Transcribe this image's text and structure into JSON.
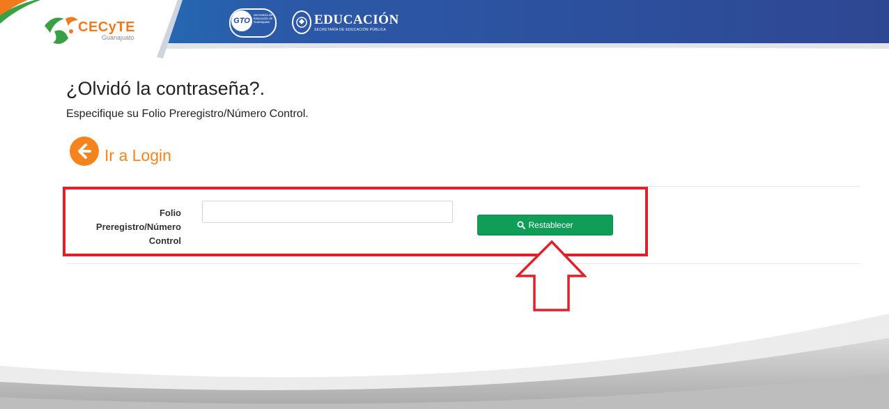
{
  "header": {
    "logo_text": "CECyTE",
    "logo_sub": "Guanajuato",
    "gto_badge": "GTO",
    "gto_sub": "Secretaría de Educación de Guanajuato",
    "edu_title": "EDUCACIÓN",
    "edu_sub": "SECRETARÍA DE EDUCACIÓN PÚBLICA"
  },
  "main": {
    "title": "¿Olvidó la contraseña?.",
    "subtitle": "Especifique su Folio Preregistro/Número Control.",
    "back_link": "Ir a Login"
  },
  "form": {
    "label": "Folio Preregistro/Número Control",
    "input_value": "",
    "button_label": "Restablecer"
  },
  "colors": {
    "header_blue": "#2b4a9a",
    "accent_orange": "#f5841f",
    "button_green": "#0f9d58",
    "highlight_red": "#e0202a"
  },
  "icons": {
    "back": "arrow-left-circle-icon",
    "button": "search-icon"
  }
}
